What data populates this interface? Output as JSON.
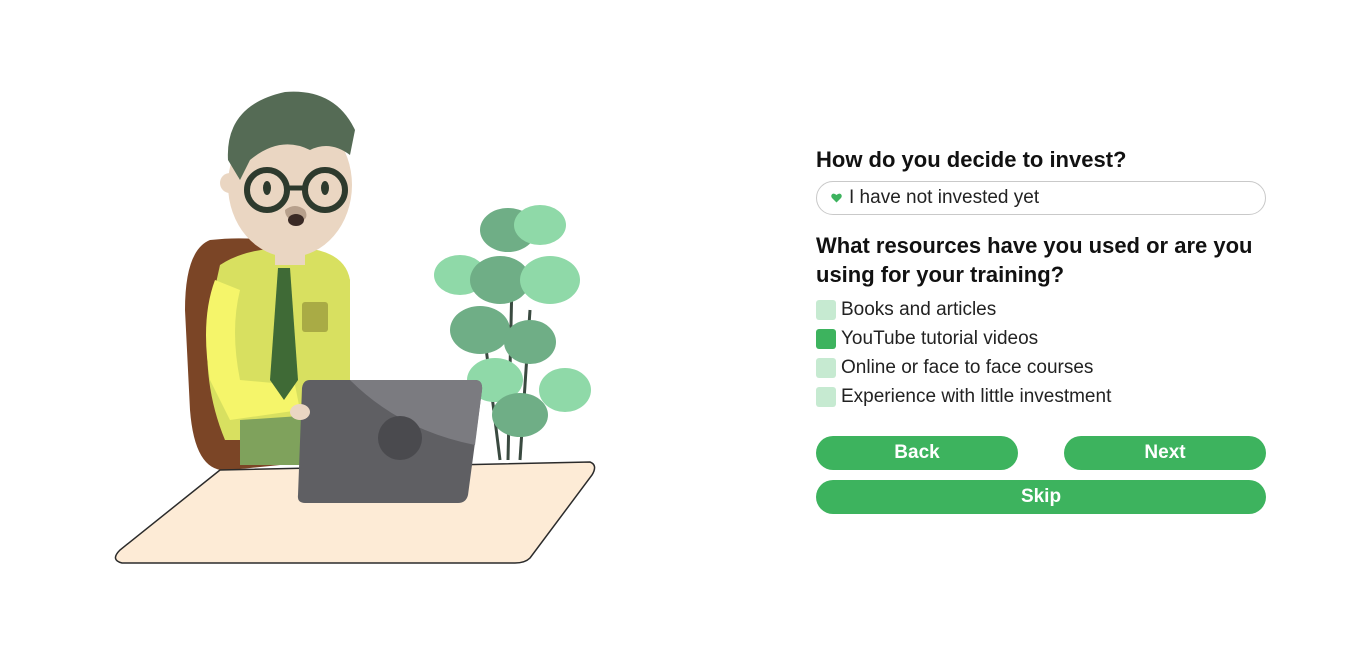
{
  "question1": {
    "title": "How do you decide to invest?",
    "selected_value": "I have not invested yet"
  },
  "question2": {
    "title": "What resources have you used or are you using for your training?",
    "options": [
      {
        "label": "Books and articles",
        "checked": false
      },
      {
        "label": "YouTube tutorial videos",
        "checked": true
      },
      {
        "label": "Online or face to face courses",
        "checked": false
      },
      {
        "label": "Experience with little investment",
        "checked": false
      }
    ]
  },
  "buttons": {
    "back": "Back",
    "next": "Next",
    "skip": "Skip"
  },
  "colors": {
    "accent": "#3db35e",
    "unchecked": "#c6ead1"
  },
  "icons": {
    "select_marker": "heart-icon"
  }
}
